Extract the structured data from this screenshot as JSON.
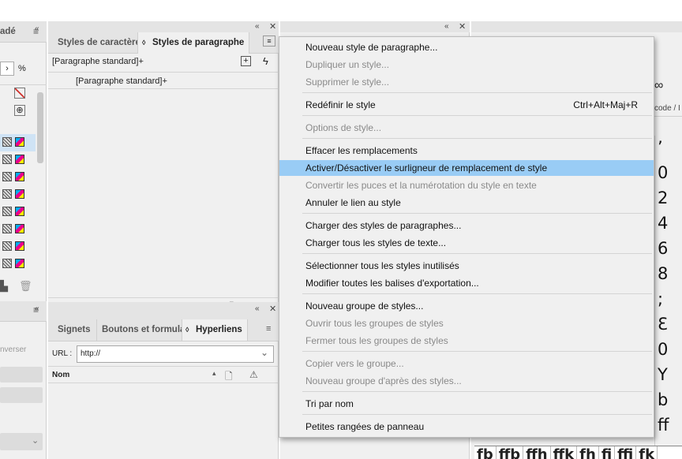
{
  "left_panel": {
    "title_partial": "adé",
    "zoom_unit": "%",
    "bottom_text_partial": "nverser"
  },
  "char_para_panel": {
    "tabs": [
      {
        "label": "Styles de caractère"
      },
      {
        "label": "Styles de paragraphe"
      }
    ],
    "current_style": "[Paragraphe standard]+",
    "list": [
      "[Paragraphe standard]+"
    ]
  },
  "links_panel": {
    "tabs": [
      {
        "label": "Signets"
      },
      {
        "label": "Boutons et formula"
      },
      {
        "label": "Hyperliens"
      }
    ],
    "url_label": "URL :",
    "url_value": "http://",
    "column_name": "Nom"
  },
  "glyph_panel": {
    "header_partial": "code / I",
    "glyphs": [
      "’",
      "0",
      "2",
      "4",
      "6",
      "8",
      ";",
      "Ɛ",
      "0",
      "Y",
      "b",
      "ff"
    ],
    "bottom_row": [
      "fb",
      "ffb",
      "ffh",
      "ffk",
      "fh",
      "fi",
      "ffi",
      "fk"
    ]
  },
  "menu": {
    "items": [
      {
        "label": "Nouveau style de paragraphe...",
        "disabled": false
      },
      {
        "label": "Dupliquer un style...",
        "disabled": true
      },
      {
        "label": "Supprimer le style...",
        "disabled": true
      },
      {
        "label": "Redéfinir le style",
        "shortcut": "Ctrl+Alt+Maj+R",
        "disabled": false
      },
      {
        "label": "Options de style...",
        "disabled": true
      },
      {
        "label": "Effacer les remplacements",
        "disabled": false
      },
      {
        "label": "Activer/Désactiver le surligneur de remplacement de style",
        "disabled": false,
        "highlighted": true
      },
      {
        "label": "Convertir les puces et la numérotation du style en texte",
        "disabled": true
      },
      {
        "label": "Annuler le lien au style",
        "disabled": false
      },
      {
        "label": "Charger des styles de paragraphes...",
        "disabled": false
      },
      {
        "label": "Charger tous les styles de texte...",
        "disabled": false
      },
      {
        "label": "Sélectionner tous les styles inutilisés",
        "disabled": false
      },
      {
        "label": "Modifier toutes les balises d'exportation...",
        "disabled": false
      },
      {
        "label": "Nouveau groupe de styles...",
        "disabled": false
      },
      {
        "label": "Ouvrir tous les groupes de styles",
        "disabled": true
      },
      {
        "label": "Fermer tous les groupes de styles",
        "disabled": true
      },
      {
        "label": "Copier vers le groupe...",
        "disabled": true
      },
      {
        "label": "Nouveau groupe d'après des styles...",
        "disabled": true
      },
      {
        "label": "Tri par nom",
        "disabled": false
      },
      {
        "label": "Petites rangées de panneau",
        "disabled": false
      }
    ]
  },
  "colors": {
    "highlight": "#99ccf5",
    "panel": "#f0f0f0",
    "header": "#e4e4e4"
  }
}
